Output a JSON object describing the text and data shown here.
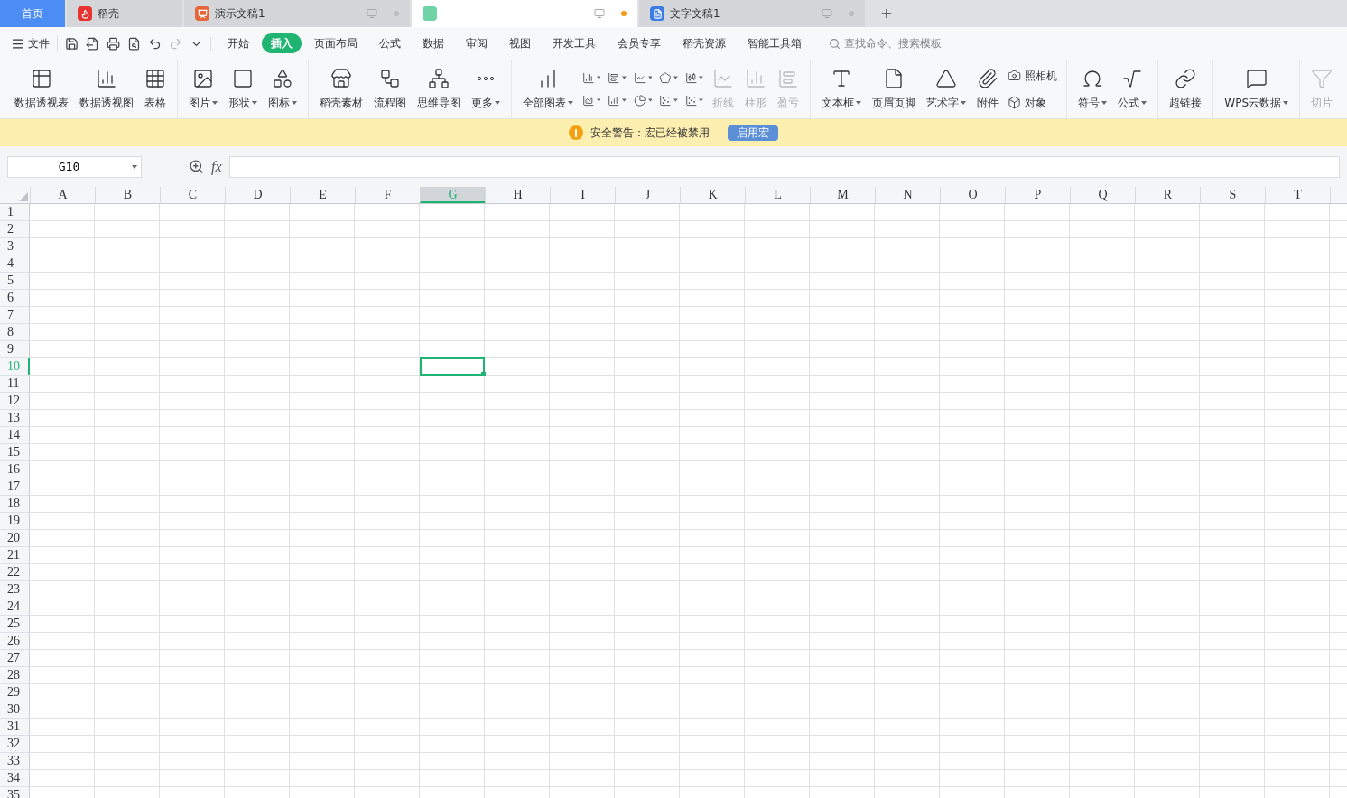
{
  "tabs": [
    {
      "kind": "home",
      "label": "首页",
      "selected": false
    },
    {
      "kind": "daoke",
      "label": "稻壳",
      "selected": false
    },
    {
      "kind": "slides",
      "label": "演示文稿1",
      "selected": false,
      "modified": false
    },
    {
      "kind": "sheet",
      "selected": true,
      "modified": true
    },
    {
      "kind": "writer",
      "label": "文字文稿1",
      "selected": false,
      "modified": false
    }
  ],
  "menu": {
    "file": "文件",
    "tabs": [
      {
        "label": "开始",
        "selected": false
      },
      {
        "label": "插入",
        "selected": true
      },
      {
        "label": "页面布局",
        "selected": false
      },
      {
        "label": "公式",
        "selected": false
      },
      {
        "label": "数据",
        "selected": false
      },
      {
        "label": "审阅",
        "selected": false
      },
      {
        "label": "视图",
        "selected": false
      },
      {
        "label": "开发工具",
        "selected": false
      },
      {
        "label": "会员专享",
        "selected": false
      },
      {
        "label": "稻壳资源",
        "selected": false
      },
      {
        "label": "智能工具箱",
        "selected": false
      }
    ],
    "search": {
      "placeholder": "查找命令、搜索模板"
    }
  },
  "ribbon": [
    [
      {
        "kind": "large",
        "label": "数据透视表",
        "dropdown": false,
        "disabled": false
      },
      {
        "kind": "large",
        "label": "数据透视图",
        "dropdown": false,
        "disabled": false
      },
      {
        "kind": "large",
        "label": "表格",
        "dropdown": false,
        "disabled": false
      }
    ],
    [
      {
        "kind": "large",
        "label": "图片",
        "dropdown": true,
        "disabled": false
      },
      {
        "kind": "large",
        "label": "形状",
        "dropdown": true,
        "disabled": false
      },
      {
        "kind": "large",
        "label": "图标",
        "dropdown": true,
        "disabled": false
      }
    ],
    [
      {
        "kind": "large",
        "label": "稻壳素材",
        "dropdown": false,
        "disabled": false
      },
      {
        "kind": "large",
        "label": "流程图",
        "dropdown": false,
        "disabled": false
      },
      {
        "kind": "large",
        "label": "思维导图",
        "dropdown": false,
        "disabled": false
      },
      {
        "kind": "large",
        "label": "更多",
        "dropdown": true,
        "disabled": false
      }
    ],
    [
      {
        "kind": "large",
        "label": "全部图表",
        "dropdown": true,
        "disabled": false
      },
      {
        "kind": "icons"
      },
      {
        "kind": "large",
        "label": "折线",
        "dropdown": false,
        "disabled": true
      },
      {
        "kind": "large",
        "label": "柱形",
        "dropdown": false,
        "disabled": true
      },
      {
        "kind": "large",
        "label": "盈亏",
        "dropdown": false,
        "disabled": true
      }
    ],
    [
      {
        "kind": "large",
        "label": "文本框",
        "dropdown": true,
        "disabled": false
      },
      {
        "kind": "large",
        "label": "页眉页脚",
        "dropdown": false,
        "disabled": false
      },
      {
        "kind": "large",
        "label": "艺术字",
        "dropdown": true,
        "disabled": false
      },
      {
        "kind": "large",
        "label": "附件",
        "dropdown": false,
        "disabled": false
      },
      {
        "kind": "small",
        "label": "照相机"
      },
      {
        "kind": "small",
        "label": "对象"
      }
    ],
    [
      {
        "kind": "large",
        "label": "符号",
        "dropdown": true,
        "disabled": false
      },
      {
        "kind": "large",
        "label": "公式",
        "dropdown": true,
        "disabled": false
      }
    ],
    [
      {
        "kind": "large",
        "label": "超链接",
        "dropdown": false,
        "disabled": false
      }
    ],
    [
      {
        "kind": "large",
        "label": "WPS云数据",
        "dropdown": true,
        "disabled": false
      }
    ],
    [
      {
        "kind": "large",
        "label": "切片",
        "dropdown": false,
        "disabled": true
      }
    ]
  ],
  "warning": {
    "text": "安全警告：宏已经被禁用",
    "button": "启用宏"
  },
  "formula_bar": {
    "name_box": "G10",
    "fx": "fx"
  },
  "sheet": {
    "columns": [
      {
        "label": "A",
        "selected": false
      },
      {
        "label": "B",
        "selected": false
      },
      {
        "label": "C",
        "selected": false
      },
      {
        "label": "D",
        "selected": false
      },
      {
        "label": "E",
        "selected": false
      },
      {
        "label": "F",
        "selected": false
      },
      {
        "label": "G",
        "selected": true
      },
      {
        "label": "H",
        "selected": false
      },
      {
        "label": "I",
        "selected": false
      },
      {
        "label": "J",
        "selected": false
      },
      {
        "label": "K",
        "selected": false
      },
      {
        "label": "L",
        "selected": false
      },
      {
        "label": "M",
        "selected": false
      },
      {
        "label": "N",
        "selected": false
      },
      {
        "label": "O",
        "selected": false
      },
      {
        "label": "P",
        "selected": false
      },
      {
        "label": "Q",
        "selected": false
      },
      {
        "label": "R",
        "selected": false
      },
      {
        "label": "S",
        "selected": false
      },
      {
        "label": "T",
        "selected": false
      }
    ],
    "rows": [
      {
        "label": "1",
        "selected": false
      },
      {
        "label": "2",
        "selected": false
      },
      {
        "label": "3",
        "selected": false
      },
      {
        "label": "4",
        "selected": false
      },
      {
        "label": "5",
        "selected": false
      },
      {
        "label": "6",
        "selected": false
      },
      {
        "label": "7",
        "selected": false
      },
      {
        "label": "8",
        "selected": false
      },
      {
        "label": "9",
        "selected": false
      },
      {
        "label": "10",
        "selected": true
      },
      {
        "label": "11",
        "selected": false
      },
      {
        "label": "12",
        "selected": false
      },
      {
        "label": "13",
        "selected": false
      },
      {
        "label": "14",
        "selected": false
      },
      {
        "label": "15",
        "selected": false
      },
      {
        "label": "16",
        "selected": false
      },
      {
        "label": "17",
        "selected": false
      },
      {
        "label": "18",
        "selected": false
      },
      {
        "label": "19",
        "selected": false
      },
      {
        "label": "20",
        "selected": false
      },
      {
        "label": "21",
        "selected": false
      },
      {
        "label": "22",
        "selected": false
      },
      {
        "label": "23",
        "selected": false
      },
      {
        "label": "24",
        "selected": false
      },
      {
        "label": "25",
        "selected": false
      },
      {
        "label": "26",
        "selected": false
      },
      {
        "label": "27",
        "selected": false
      },
      {
        "label": "28",
        "selected": false
      },
      {
        "label": "29",
        "selected": false
      },
      {
        "label": "30",
        "selected": false
      },
      {
        "label": "31",
        "selected": false
      },
      {
        "label": "32",
        "selected": false
      },
      {
        "label": "33",
        "selected": false
      },
      {
        "label": "34",
        "selected": false
      },
      {
        "label": "35",
        "selected": false
      }
    ]
  }
}
